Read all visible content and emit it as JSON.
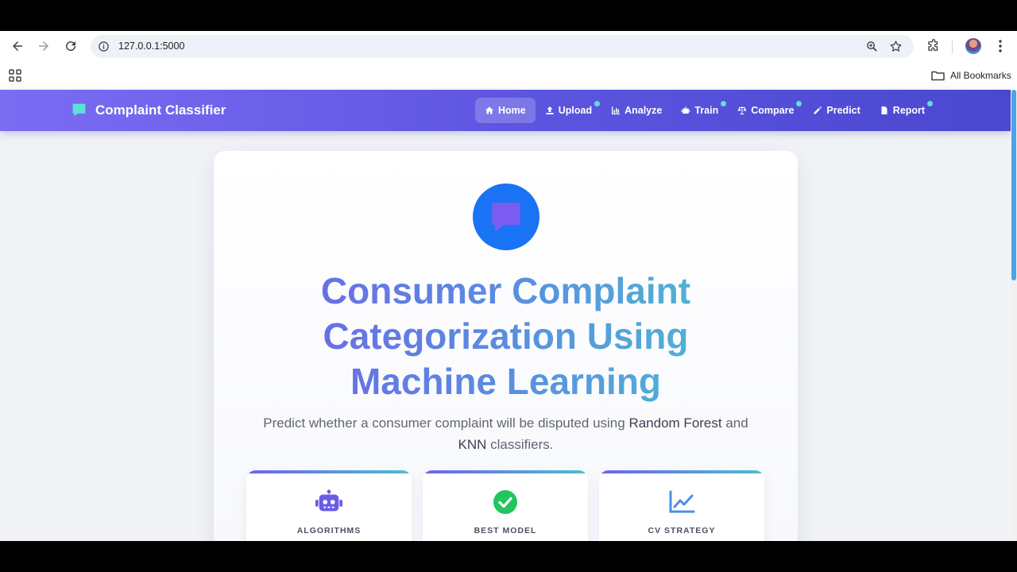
{
  "browser": {
    "url": "127.0.0.1:5000",
    "bookmarks_label": "All Bookmarks"
  },
  "app": {
    "brand": "Complaint Classifier",
    "menu": [
      {
        "label": "Home",
        "icon": "home-icon",
        "active": true,
        "dot": false
      },
      {
        "label": "Upload",
        "icon": "upload-icon",
        "active": false,
        "dot": true
      },
      {
        "label": "Analyze",
        "icon": "chart-icon",
        "active": false,
        "dot": false
      },
      {
        "label": "Train",
        "icon": "robot-icon",
        "active": false,
        "dot": true
      },
      {
        "label": "Compare",
        "icon": "scale-icon",
        "active": false,
        "dot": true
      },
      {
        "label": "Predict",
        "icon": "pencil-icon",
        "active": false,
        "dot": false
      },
      {
        "label": "Report",
        "icon": "file-icon",
        "active": false,
        "dot": true
      }
    ]
  },
  "hero": {
    "title_lines": [
      "Consumer Complaint",
      "Categorization Using",
      "Machine Learning"
    ],
    "subtitle_pre": "Predict whether a consumer complaint will be disputed using ",
    "subtitle_em1": "Random Forest",
    "subtitle_mid": " and ",
    "subtitle_em2": "KNN",
    "subtitle_post": " classifiers."
  },
  "stats": [
    {
      "label": "ALGORITHMS",
      "icon": "robot-icon"
    },
    {
      "label": "BEST MODEL",
      "icon": "check-circle-icon"
    },
    {
      "label": "CV STRATEGY",
      "icon": "line-chart-icon"
    }
  ],
  "colors": {
    "nav_start": "#7c6cf3",
    "nav_end": "#4b47cf",
    "hero_icon": "#1a73f5",
    "accent_teal": "#5ee0d6",
    "robot_purple": "#6b5ce8",
    "check_green": "#22c55e",
    "chart_blue": "#4a8fe6"
  }
}
